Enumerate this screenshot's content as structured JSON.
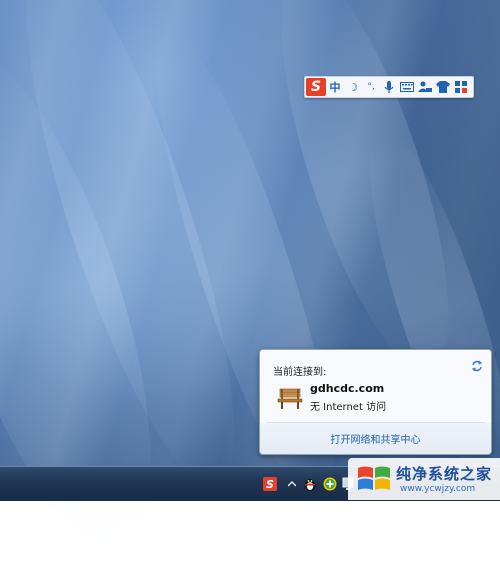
{
  "ime_toolbar": {
    "logo": "S",
    "items": [
      {
        "icon": "chinese-mode",
        "glyph": "中"
      },
      {
        "icon": "moon-icon",
        "glyph": "☽"
      },
      {
        "icon": "punctuation-icon",
        "glyph": "°,"
      },
      {
        "icon": "microphone-icon",
        "glyph": ""
      },
      {
        "icon": "keyboard-icon",
        "glyph": ""
      },
      {
        "icon": "user-icon",
        "glyph": ""
      },
      {
        "icon": "shirt-icon",
        "glyph": ""
      },
      {
        "icon": "grid-icon",
        "glyph": ""
      }
    ]
  },
  "network_popup": {
    "header": "当前连接到:",
    "network_name": "gdhcdc.com",
    "network_status": "无 Internet 访问",
    "open_center_link": "打开网络和共享中心"
  },
  "watermark": {
    "text": "纯净系统之家",
    "url": "www.ycwjzy.com"
  },
  "colors": {
    "ime_logo": "#e7402a",
    "link": "#1b5fb5",
    "taskbar": "#1e3553"
  }
}
